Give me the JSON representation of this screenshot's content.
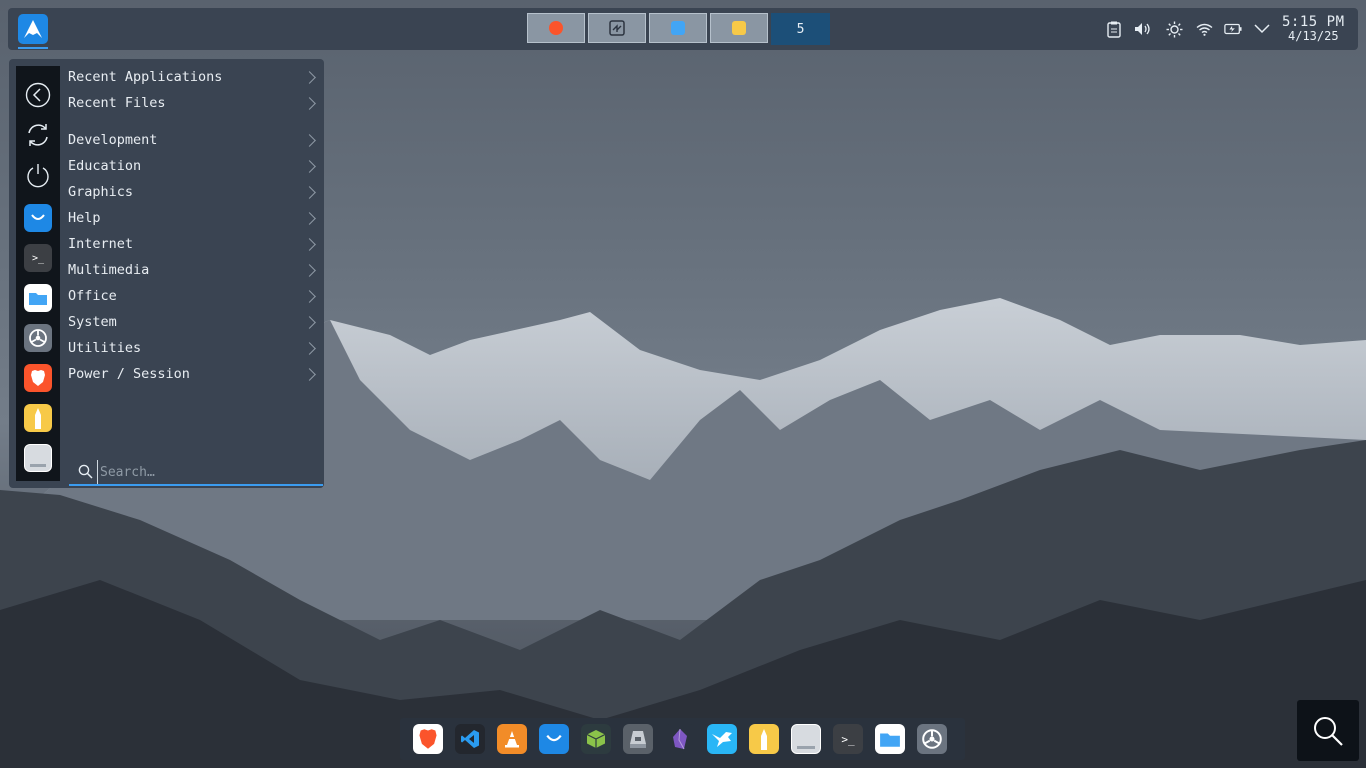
{
  "top_panel": {
    "launcher_icon": "arch-logo-icon",
    "tasks": [
      {
        "name": "brave-task",
        "icon": "brave-icon",
        "color": "#fb542b"
      },
      {
        "name": "installer-task",
        "icon": "installer-icon",
        "color": "#5b6b7a"
      },
      {
        "name": "files-task",
        "icon": "folder-icon",
        "color": "#42a5f5"
      },
      {
        "name": "pencil-task",
        "icon": "pencil-icon",
        "color": "#f7c948"
      }
    ],
    "workspace_count": "5",
    "tray": [
      "clipboard-icon",
      "volume-icon",
      "brightness-icon",
      "wifi-icon",
      "battery-icon",
      "chevron-down-icon"
    ],
    "clock": {
      "time": "5:15 PM",
      "date": "4/13/25"
    }
  },
  "menu": {
    "sidebar": {
      "actions": [
        "back-icon",
        "refresh-icon",
        "power-icon"
      ],
      "favorites": [
        {
          "name": "software-store",
          "icon": "shopping-bag-icon",
          "color": "#1e88e5"
        },
        {
          "name": "terminal",
          "icon": "terminal-icon",
          "color": "#3c3f44"
        },
        {
          "name": "files",
          "icon": "folder-icon",
          "color": "#ffffff"
        },
        {
          "name": "settings",
          "icon": "gear-icon",
          "color": "#6b7480"
        },
        {
          "name": "brave",
          "icon": "brave-icon",
          "color": "#fb542b"
        },
        {
          "name": "pencil",
          "icon": "pencil-icon",
          "color": "#f7c948"
        },
        {
          "name": "disks",
          "icon": "disk-icon",
          "color": "#d7dbe0"
        }
      ]
    },
    "items": [
      {
        "label": "Recent Applications"
      },
      {
        "label": "Recent Files"
      },
      {
        "label": "Development"
      },
      {
        "label": "Education"
      },
      {
        "label": "Graphics"
      },
      {
        "label": "Help"
      },
      {
        "label": "Internet"
      },
      {
        "label": "Multimedia"
      },
      {
        "label": "Office"
      },
      {
        "label": "System"
      },
      {
        "label": "Utilities"
      },
      {
        "label": "Power / Session"
      }
    ],
    "search": {
      "placeholder": "Search…"
    }
  },
  "dock": {
    "items": [
      {
        "name": "brave",
        "icon": "brave-icon",
        "color": "#fb542b"
      },
      {
        "name": "vscode",
        "icon": "vscode-icon",
        "color": "#23272e"
      },
      {
        "name": "vlc",
        "icon": "vlc-icon",
        "color": "#f28c28"
      },
      {
        "name": "software-store",
        "icon": "shopping-bag-icon",
        "color": "#1e88e5"
      },
      {
        "name": "package",
        "icon": "package-icon",
        "color": "#2d3b3f"
      },
      {
        "name": "disk-install",
        "icon": "hard-drive-icon",
        "color": "#5a6169"
      },
      {
        "name": "obsidian",
        "icon": "obsidian-icon",
        "color": "#7e57c2"
      },
      {
        "name": "flutter-app",
        "icon": "bird-icon",
        "color": "#29b6f6"
      },
      {
        "name": "pencil",
        "icon": "pencil-icon",
        "color": "#f7c948"
      },
      {
        "name": "disks",
        "icon": "disk-icon",
        "color": "#d7dbe0"
      },
      {
        "name": "terminal",
        "icon": "terminal-icon",
        "color": "#3c3f44"
      },
      {
        "name": "files",
        "icon": "folder-icon",
        "color": "#ffffff"
      },
      {
        "name": "settings",
        "icon": "gear-icon",
        "color": "#6b7480"
      }
    ]
  },
  "corner": {
    "icon": "search-icon"
  }
}
